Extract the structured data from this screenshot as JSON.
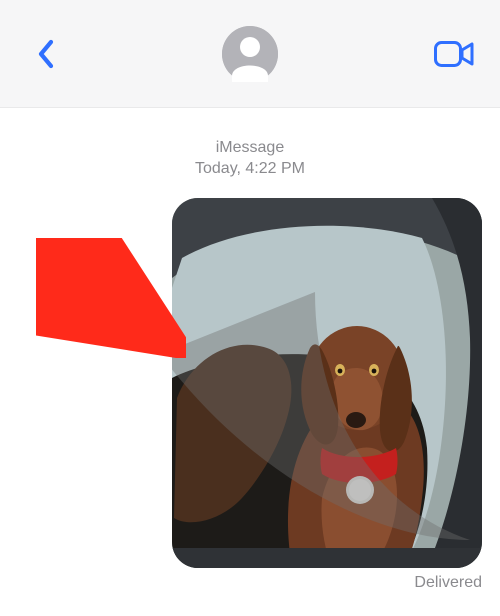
{
  "header": {
    "back_icon": "chevron-left",
    "video_icon": "video-camera",
    "avatar_icon": "person-silhouette",
    "accent_color": "#2f6fff"
  },
  "thread": {
    "service_label": "iMessage",
    "timestamp_prefix": "Today,",
    "timestamp_time": "4:22 PM",
    "status_label": "Delivered",
    "attachment": {
      "description": "Photo of a brown dog with a red collar and tag looking out of a car window",
      "semantic": "sent-photo-attachment"
    }
  },
  "annotation": {
    "arrow_color": "#ff2a1a",
    "arrow_target": "sent-photo-attachment"
  }
}
